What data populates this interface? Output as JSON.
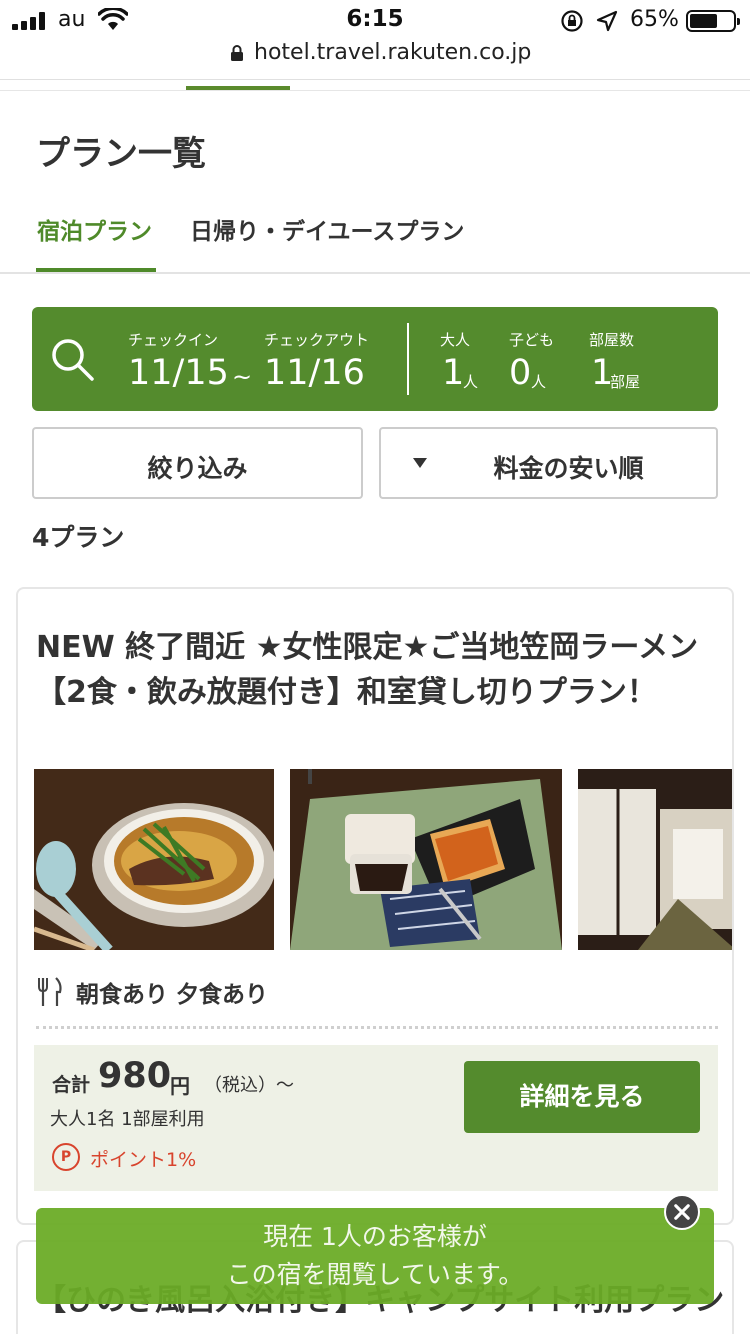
{
  "status_bar": {
    "carrier": "au",
    "time": "6:15",
    "battery_percent": "65%",
    "battery_level": 0.65
  },
  "browser": {
    "url": "hotel.travel.rakuten.co.jp"
  },
  "page": {
    "title": "プラン一覧",
    "tabs": [
      {
        "label": "宿泊プラン",
        "active": true
      },
      {
        "label": "日帰り・デイユースプラン",
        "active": false
      }
    ]
  },
  "search": {
    "checkin_label": "チェックイン",
    "checkin_value": "11/15",
    "range_sep": "~",
    "checkout_label": "チェックアウト",
    "checkout_value": "11/16",
    "adults_label": "大人",
    "adults_value": "1",
    "adults_unit": "人",
    "children_label": "子ども",
    "children_value": "0",
    "children_unit": "人",
    "rooms_label": "部屋数",
    "rooms_value": "1",
    "rooms_unit": "部屋",
    "accent_color": "#548b2d"
  },
  "controls": {
    "filter_label": "絞り込み",
    "sort_label": "料金の安い順"
  },
  "results": {
    "count_label": "4プラン"
  },
  "plans": [
    {
      "title": "NEW 終了間近 ★女性限定★ご当地笠岡ラーメン【2食・飲み放題付き】和室貸し切りプラン！",
      "photos": [
        "ramen-photo",
        "coffee-toast-photo",
        "japanese-room-photo"
      ],
      "meals": "朝食あり 夕食あり",
      "total_label": "合計",
      "price": "980",
      "currency": "円",
      "tax_note": "（税込）～",
      "occupancy": "大人1名 1部屋利用",
      "point_badge": "P",
      "points": "ポイント1%",
      "detail_label": "詳細を見る"
    },
    {
      "title": "【ひのき風呂入浴付き】キャンプサイト利用プラン"
    }
  ],
  "toast": {
    "line1": "現在 1人のお客様が",
    "line2": "この宿を閲覧しています。"
  }
}
